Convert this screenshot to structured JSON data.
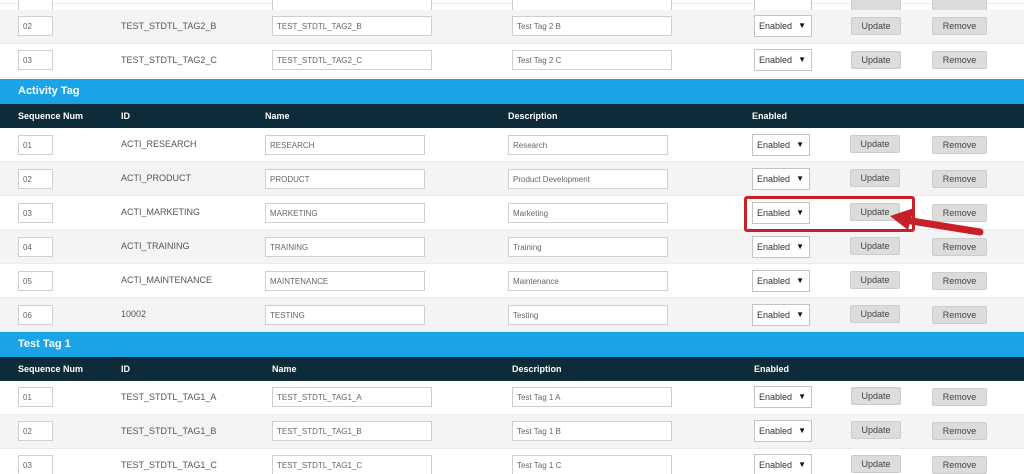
{
  "placeholder_note": "",
  "options": {
    "enabled_label": "Enabled",
    "caret": "▼"
  },
  "buttons": {
    "update": "Update",
    "remove": "Remove"
  },
  "headers": {
    "seq": "Sequence Num",
    "id": "ID",
    "name": "Name",
    "description": "Description",
    "enabled": "Enabled"
  },
  "tag2": {
    "rows": [
      {
        "seq": "02",
        "id": "TEST_STDTL_TAG2_B",
        "name": "TEST_STDTL_TAG2_B",
        "description": "Test Tag 2 B",
        "enabled": "Enabled"
      },
      {
        "seq": "03",
        "id": "TEST_STDTL_TAG2_C",
        "name": "TEST_STDTL_TAG2_C",
        "description": "Test Tag 2 C",
        "enabled": "Enabled"
      }
    ]
  },
  "activity": {
    "title": "Activity Tag",
    "rows": [
      {
        "seq": "01",
        "id": "ACTI_RESEARCH",
        "name": "RESEARCH",
        "description": "Research",
        "enabled": "Enabled"
      },
      {
        "seq": "02",
        "id": "ACTI_PRODUCT",
        "name": "PRODUCT",
        "description": "Product Development",
        "enabled": "Enabled"
      },
      {
        "seq": "03",
        "id": "ACTI_MARKETING",
        "name": "MARKETING",
        "description": "Marketing",
        "enabled": "Enabled"
      },
      {
        "seq": "04",
        "id": "ACTI_TRAINING",
        "name": "TRAINING",
        "description": "Training",
        "enabled": "Enabled"
      },
      {
        "seq": "05",
        "id": "ACTI_MAINTENANCE",
        "name": "MAINTENANCE",
        "description": "Maintenance",
        "enabled": "Enabled"
      },
      {
        "seq": "06",
        "id": "10002",
        "name": "TESTING",
        "description": "Testing",
        "enabled": "Enabled"
      }
    ]
  },
  "tag1": {
    "title": "Test Tag 1",
    "rows": [
      {
        "seq": "01",
        "id": "TEST_STDTL_TAG1_A",
        "name": "TEST_STDTL_TAG1_A",
        "description": "Test Tag 1 A",
        "enabled": "Enabled"
      },
      {
        "seq": "02",
        "id": "TEST_STDTL_TAG1_B",
        "name": "TEST_STDTL_TAG1_B",
        "description": "Test Tag 1 B",
        "enabled": "Enabled"
      },
      {
        "seq": "03",
        "id": "TEST_STDTL_TAG1_C",
        "name": "TEST_STDTL_TAG1_C",
        "description": "Test Tag 1 C",
        "enabled": "Enabled"
      }
    ]
  },
  "colors": {
    "section_bar": "#1aa3e6",
    "header_bar": "#0e2b39",
    "highlight": "#c8202a"
  }
}
